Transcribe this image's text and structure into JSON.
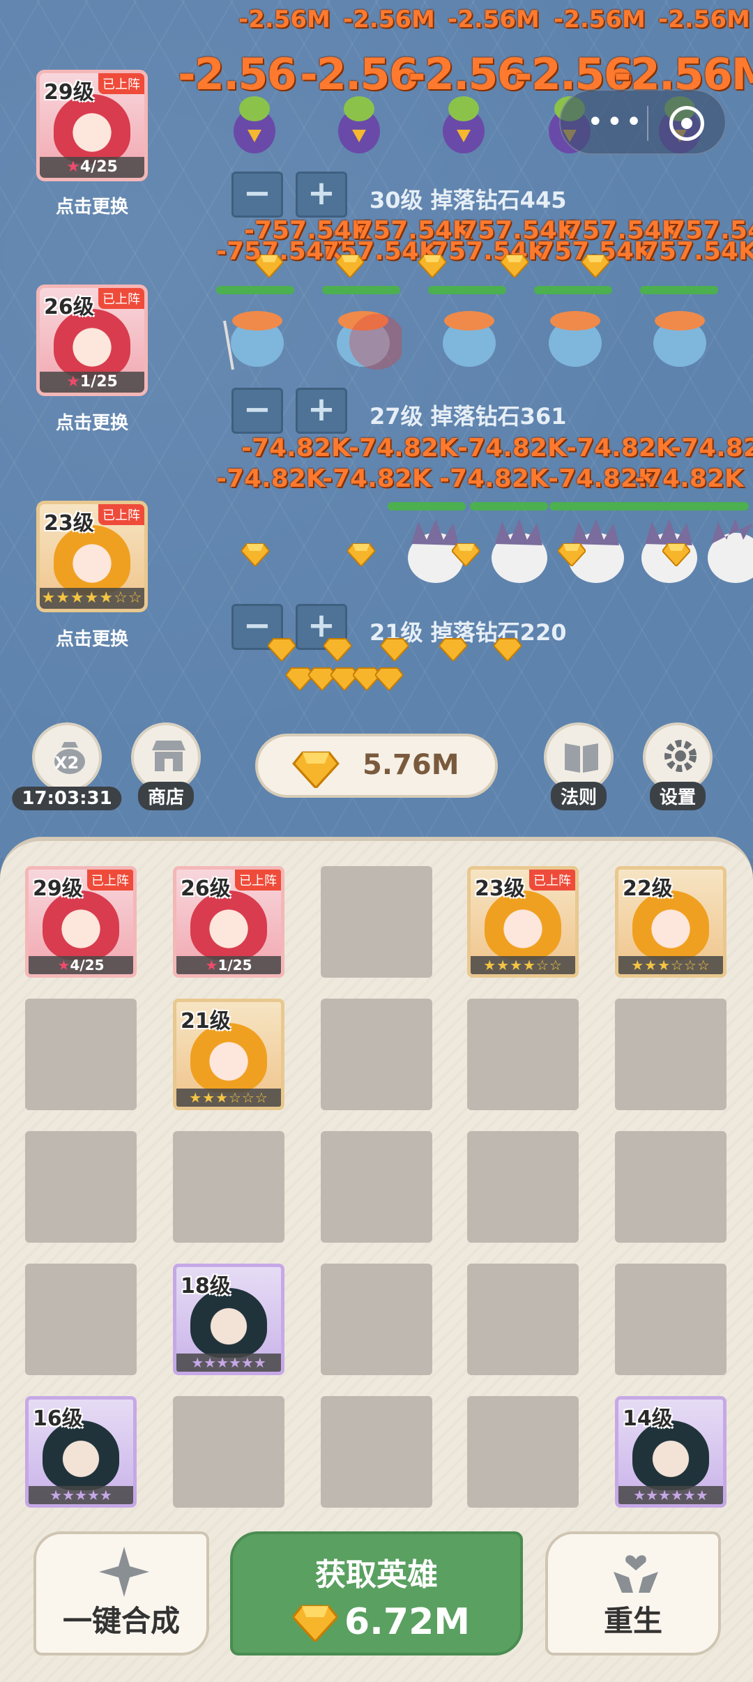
{
  "damage": {
    "lane1_small": [
      "-2.56M",
      "-2.56M",
      "-2.56M",
      "-2.56M",
      "-2.56M"
    ],
    "lane1_big": [
      "-2.56",
      "-2.56",
      "-2.56",
      "-2.56",
      "-2.56M"
    ],
    "lane2_top": [
      "-757.54K",
      "757.54K",
      "757.54K",
      "757.54K",
      "757.54"
    ],
    "lane2_bottom": [
      "-757.54K",
      "757.54K",
      "757.54K",
      "757.54K",
      "757.54K"
    ],
    "lane3_top": [
      "-74.82K",
      "-74.82K",
      "-74.82K",
      "-74.82K",
      "-74.82K"
    ],
    "lane3_bottom": [
      "-74.82K",
      "-74.82K",
      "-74.82K",
      "-74.82K",
      "-74.82K"
    ]
  },
  "lanes": [
    {
      "level": "29级",
      "tag": "已上阵",
      "stars": "4/25",
      "change": "点击更换",
      "info": "30级 掉落钻石445"
    },
    {
      "level": "26级",
      "tag": "已上阵",
      "stars": "1/25",
      "change": "点击更换",
      "info": "27级 掉落钻石361"
    },
    {
      "level": "23级",
      "tag": "已上阵",
      "stars": "★★★★★☆☆",
      "change": "点击更换",
      "info": "21级 掉落钻石220"
    }
  ],
  "controls": {
    "minus": "−",
    "plus": "+"
  },
  "toolbar": {
    "x2_badge": "X2",
    "timer": "17:03:31",
    "shop": "商店",
    "gems": "5.76M",
    "rules": "法则",
    "settings": "设置"
  },
  "grid": {
    "c1": {
      "level": "29级",
      "tag": "已上阵",
      "stars": "4/25"
    },
    "c2": {
      "level": "26级",
      "tag": "已上阵",
      "stars": "1/25"
    },
    "c4": {
      "level": "23级",
      "tag": "已上阵",
      "stars": "★★★★☆☆"
    },
    "c5": {
      "level": "22级",
      "stars": "★★★☆☆☆"
    },
    "c7": {
      "level": "21级",
      "stars": "★★★☆☆☆"
    },
    "c17": {
      "level": "18级",
      "stars": "★★★★★★"
    },
    "c21": {
      "level": "16级",
      "stars": "★★★★★"
    },
    "c25": {
      "level": "14级",
      "stars": "★★★★★★"
    }
  },
  "bottom": {
    "merge": "一键合成",
    "get_hero": "获取英雄",
    "get_cost": "6.72M",
    "rebirth": "重生"
  },
  "colors": {
    "damage": "#ff7a2e",
    "accent_green": "#5aa061",
    "badge_red": "#ef4b3a"
  }
}
